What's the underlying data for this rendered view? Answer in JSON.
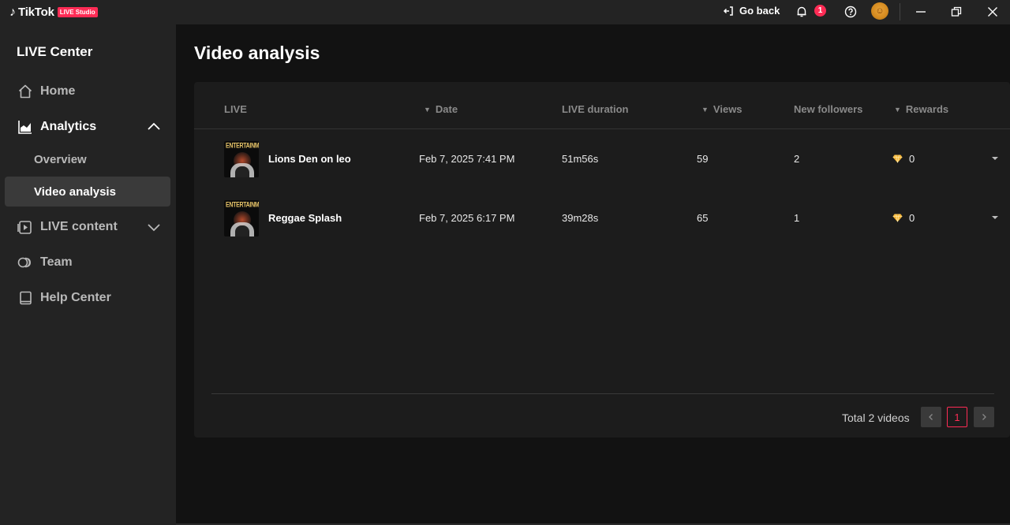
{
  "app": {
    "brand_note": "♪",
    "brand_name": "TikTok",
    "brand_badge": "LIVE Studio"
  },
  "titlebar": {
    "go_back": "Go back",
    "notification_count": "1"
  },
  "sidebar": {
    "title": "LIVE Center",
    "items": [
      {
        "label": "Home"
      },
      {
        "label": "Analytics"
      },
      {
        "label": "Overview"
      },
      {
        "label": "Video analysis"
      },
      {
        "label": "LIVE content"
      },
      {
        "label": "Team"
      },
      {
        "label": "Help Center"
      }
    ]
  },
  "main": {
    "title": "Video analysis",
    "columns": {
      "live": "LIVE",
      "date": "Date",
      "duration": "LIVE duration",
      "views": "Views",
      "followers": "New followers",
      "rewards": "Rewards"
    },
    "sort_glyph": "▼",
    "rows": [
      {
        "thumb_text": "ENTERTAINMENT",
        "title": "Lions Den on leo",
        "date": "Feb 7, 2025 7:41 PM",
        "duration": "51m56s",
        "views": "59",
        "followers": "2",
        "rewards": "0"
      },
      {
        "thumb_text": "ENTERTAINMENT",
        "title": "Reggae Splash",
        "date": "Feb 7, 2025 6:17 PM",
        "duration": "39m28s",
        "views": "65",
        "followers": "1",
        "rewards": "0"
      }
    ],
    "pagination": {
      "total": "Total 2 videos",
      "current_page": "1"
    }
  },
  "colors": {
    "accent": "#fe2c55",
    "sidebar_bg": "#232323",
    "content_bg": "#121212",
    "card_bg": "#1c1c1c"
  }
}
